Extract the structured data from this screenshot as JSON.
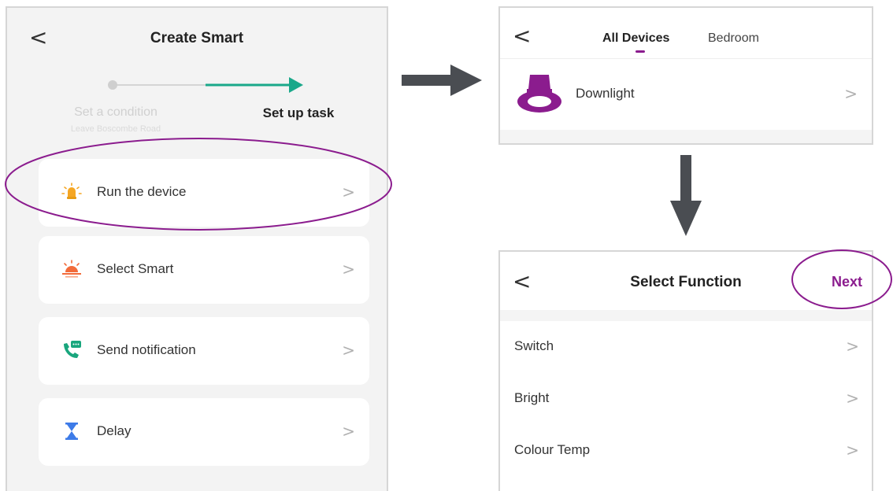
{
  "left_panel": {
    "back": "<",
    "title": "Create Smart",
    "steps": {
      "step1_label": "Set a condition",
      "step1_sub": "Leave Boscombe Road",
      "step2_label": "Set up task"
    },
    "cards": [
      {
        "label": "Run the device",
        "icon": "bulb-icon"
      },
      {
        "label": "Select Smart",
        "icon": "sunset-icon"
      },
      {
        "label": "Send notification",
        "icon": "phone-message-icon"
      },
      {
        "label": "Delay",
        "icon": "hourglass-icon"
      }
    ],
    "chevron": ">"
  },
  "right_top_panel": {
    "back": "<",
    "tabs": [
      {
        "label": "All Devices",
        "active": true
      },
      {
        "label": "Bedroom",
        "active": false
      }
    ],
    "devices": [
      {
        "label": "Downlight",
        "icon": "downlight-icon"
      }
    ],
    "chevron": ">"
  },
  "right_bottom_panel": {
    "back": "<",
    "title": "Select Function",
    "next_label": "Next",
    "functions": [
      {
        "label": "Switch"
      },
      {
        "label": "Bright"
      },
      {
        "label": "Colour Temp"
      }
    ],
    "chevron": ">"
  },
  "colors": {
    "accent_purple": "#8b1c8e",
    "teal_arrow": "#1aa88a",
    "flow_arrow": "#4a4d52",
    "card_bg": "#ffffff",
    "panel_bg": "#f3f3f3"
  }
}
